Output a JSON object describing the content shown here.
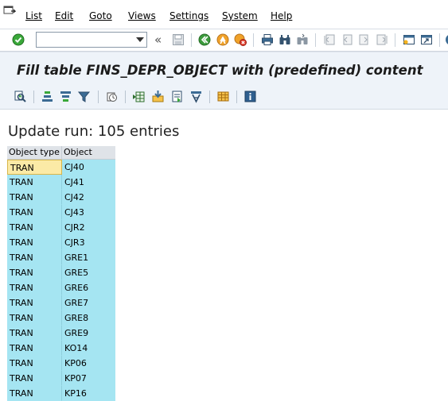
{
  "menu": {
    "items": [
      {
        "label": "List"
      },
      {
        "label": "Edit"
      },
      {
        "label": "Goto"
      },
      {
        "label": "Views"
      },
      {
        "label": "Settings"
      },
      {
        "label": "System"
      },
      {
        "label": "Help"
      }
    ]
  },
  "toolbar": {
    "command_field_value": "",
    "icons": [
      "enter-check-icon",
      "save-icon",
      "back-icon",
      "exit-icon",
      "cancel-icon",
      "print-icon",
      "find-icon",
      "find-next-icon",
      "first-page-icon",
      "previous-page-icon",
      "next-page-icon",
      "last-page-icon",
      "new-session-icon",
      "shortcut-icon"
    ]
  },
  "title": {
    "text": "Fill table FINS_DEPR_OBJECT with (predefined) content"
  },
  "app_toolbar": {
    "icons": [
      "details-icon",
      "sort-ascending-icon",
      "sort-descending-icon",
      "filter-icon",
      "display-variant-icon",
      "export-spreadsheet-icon",
      "local-file-icon",
      "word-processing-icon",
      "abc-analysis-icon",
      "choose-layout-icon",
      "information-icon"
    ]
  },
  "list": {
    "heading": "Update run: 105 entries",
    "columns": [
      "Object type",
      "Object"
    ],
    "rows": [
      [
        "TRAN",
        "CJ40"
      ],
      [
        "TRAN",
        "CJ41"
      ],
      [
        "TRAN",
        "CJ42"
      ],
      [
        "TRAN",
        "CJ43"
      ],
      [
        "TRAN",
        "CJR2"
      ],
      [
        "TRAN",
        "CJR3"
      ],
      [
        "TRAN",
        "GRE1"
      ],
      [
        "TRAN",
        "GRE5"
      ],
      [
        "TRAN",
        "GRE6"
      ],
      [
        "TRAN",
        "GRE7"
      ],
      [
        "TRAN",
        "GRE8"
      ],
      [
        "TRAN",
        "GRE9"
      ],
      [
        "TRAN",
        "KO14"
      ],
      [
        "TRAN",
        "KP06"
      ],
      [
        "TRAN",
        "KP07"
      ],
      [
        "TRAN",
        "KP16"
      ]
    ]
  },
  "colors": {
    "cell_background": "#a5e5f2",
    "selected_cell": "#fbeaa6",
    "title_bar": "#eef3f9"
  }
}
